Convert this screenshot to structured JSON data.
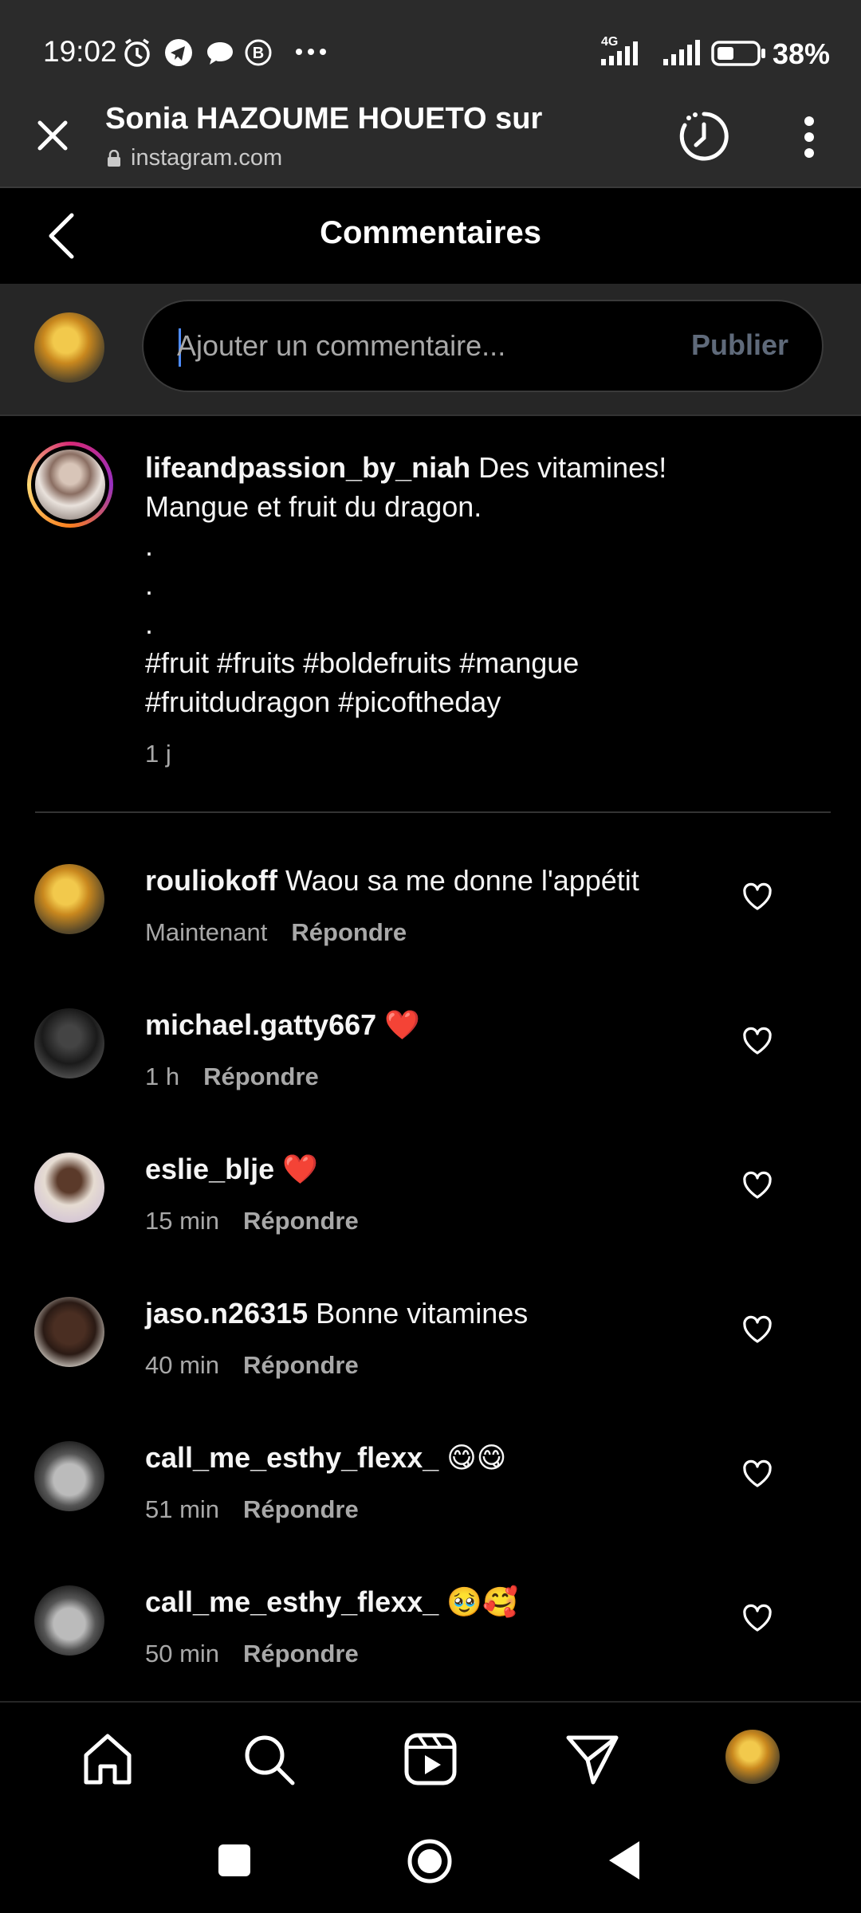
{
  "status_bar": {
    "time": "19:02",
    "network": "4G",
    "battery": "38%"
  },
  "browser": {
    "title": "Sonia HAZOUME HOUETO sur",
    "url": "instagram.com",
    "icons": [
      "close-icon",
      "history-icon",
      "more-vert-icon",
      "lock-icon"
    ]
  },
  "header": {
    "title": "Commentaires"
  },
  "composer": {
    "placeholder": "Ajouter un commentaire...",
    "publish_label": "Publier"
  },
  "caption": {
    "username": "lifeandpassion_by_niah",
    "text": " Des vitamines! Mangue et fruit du dragon.",
    "dots": [
      ".",
      ".",
      "."
    ],
    "hashtags": "#fruit #fruits #boldefruits #mangue #fruitdudragon #picoftheday",
    "time": "1 j"
  },
  "comments": [
    {
      "username": "rouliokoff",
      "text": " Waou sa me donne l'appétit",
      "time": "Maintenant",
      "reply": "Répondre"
    },
    {
      "username": "michael.gatty667",
      "text": " ❤️",
      "time": "1 h",
      "reply": "Répondre"
    },
    {
      "username": "eslie_blje",
      "text": " ❤️",
      "time": "15 min",
      "reply": "Répondre"
    },
    {
      "username": "jaso.n26315",
      "text": " Bonne vitamines",
      "time": "40 min",
      "reply": "Répondre"
    },
    {
      "username": "call_me_esthy_flexx_",
      "text": " 😋😋",
      "time": "51 min",
      "reply": "Répondre"
    },
    {
      "username": "call_me_esthy_flexx_",
      "text": " 🥹🥰",
      "time": "50 min",
      "reply": "Répondre"
    }
  ],
  "bottom_nav": [
    "home-icon",
    "search-icon",
    "reels-icon",
    "direct-icon",
    "profile-avatar"
  ],
  "colors": {
    "background": "#000000",
    "bar": "#2b2b2b",
    "muted_text": "#a8a8a8",
    "heart": "#e0245e"
  }
}
